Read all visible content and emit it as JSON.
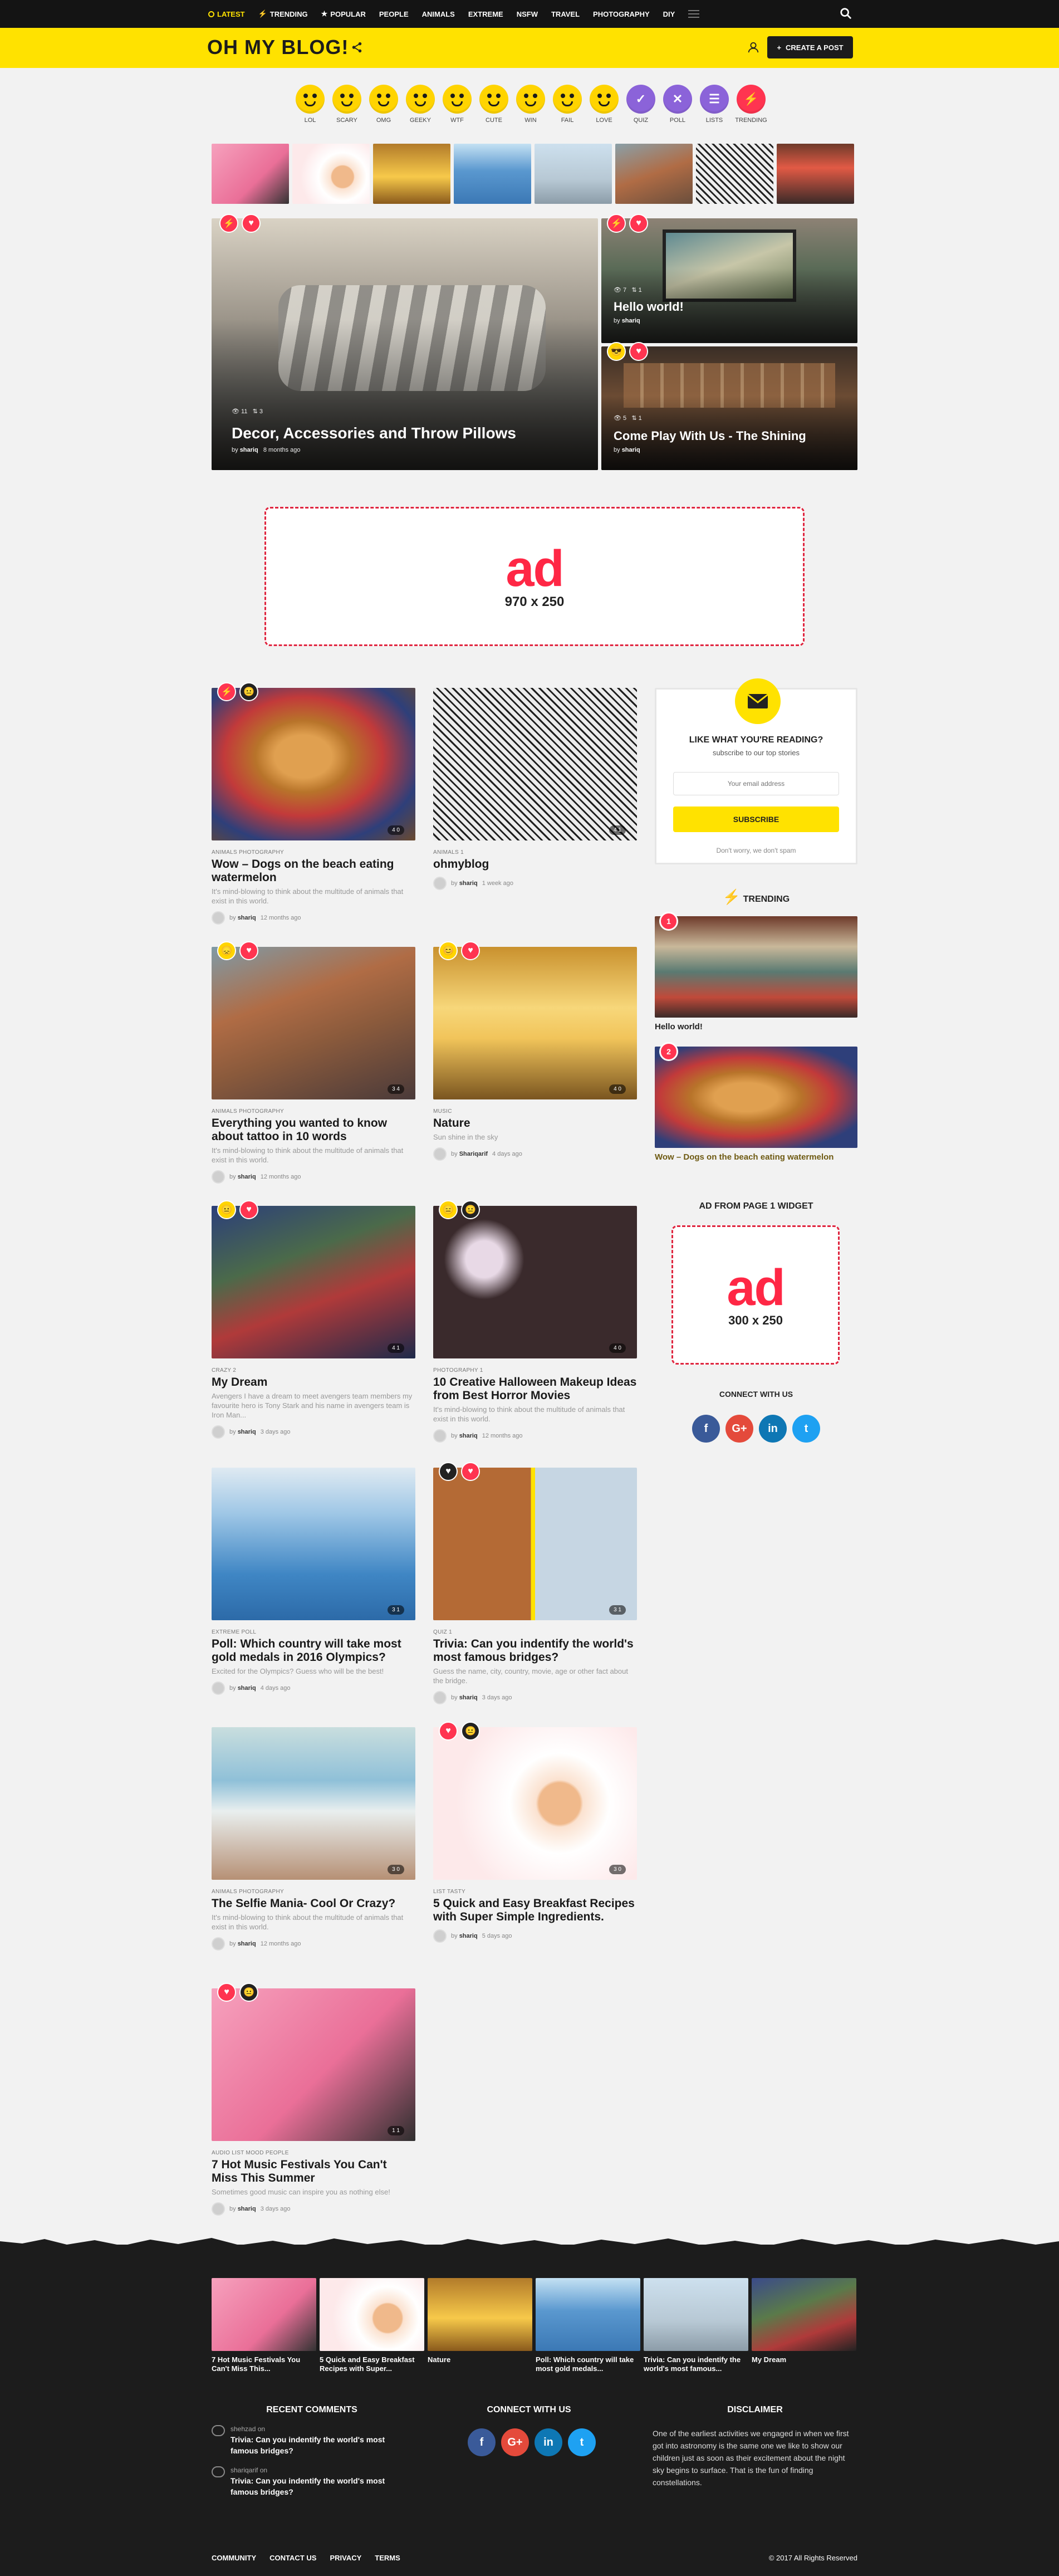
{
  "nav": {
    "items": [
      {
        "label": "LATEST",
        "active": true
      },
      {
        "label": "TRENDING",
        "icon": "bolt-icon"
      },
      {
        "label": "POPULAR",
        "icon": "star-icon"
      },
      {
        "label": "PEOPLE"
      },
      {
        "label": "ANIMALS"
      },
      {
        "label": "EXTREME"
      },
      {
        "label": "NSFW"
      },
      {
        "label": "TRAVEL"
      },
      {
        "label": "PHOTOGRAPHY"
      },
      {
        "label": "DIY"
      }
    ]
  },
  "header": {
    "logo": "OH MY BLOG!",
    "create_label": "CREATE A POST"
  },
  "reactions": [
    "LOL",
    "SCARY",
    "OMG",
    "GEEKY",
    "WTF",
    "CUTE",
    "WIN",
    "FAIL",
    "LOVE",
    "QUIZ",
    "POLL",
    "LISTS",
    "TRENDING"
  ],
  "hero": {
    "main": {
      "title": "Decor, Accessories and Throw Pillows",
      "views": "11",
      "shares": "3",
      "author": "shariq",
      "time": "8 months ago"
    },
    "side1": {
      "title": "Hello world!",
      "views": "7",
      "shares": "1",
      "author": "shariq"
    },
    "side2": {
      "title": "Come Play With Us - The Shining",
      "views": "5",
      "shares": "1",
      "author": "shariq"
    }
  },
  "ad_big": {
    "text": "ad",
    "size": "970 x 250"
  },
  "posts": [
    {
      "cats": "ANIMALS  PHOTOGRAPHY",
      "title": "Wow – Dogs on the beach eating watermelon",
      "excerpt": "It's mind-blowing to think about the multitude of animals that exist in this world.",
      "author": "shariq",
      "time": "12 months ago",
      "stat": "4  0"
    },
    {
      "cats": "ANIMALS  1",
      "title": "ohmyblog",
      "excerpt": "",
      "author": "shariq",
      "time": "1 week ago",
      "stat": "4  1"
    },
    {
      "cats": "ANIMALS  PHOTOGRAPHY",
      "title": "Everything you wanted to know about tattoo in 10 words",
      "excerpt": "It's mind-blowing to think about the multitude of animals that exist in this world.",
      "author": "shariq",
      "time": "12 months ago",
      "stat": "3  4"
    },
    {
      "cats": "MUSIC",
      "title": "Nature",
      "excerpt": "Sun shine in the sky",
      "author": "Shariqarif",
      "time": "4 days ago",
      "stat": "4  0"
    },
    {
      "cats": "CRAZY  2",
      "title": "My Dream",
      "excerpt": "Avengers I have a dream to meet avengers team members my favourite hero is Tony Stark and his name in avengers team is Iron Man...",
      "author": "shariq",
      "time": "3 days ago",
      "stat": "4  1"
    },
    {
      "cats": "PHOTOGRAPHY  1",
      "title": "10 Creative Halloween Makeup Ideas from Best Horror Movies",
      "excerpt": "It's mind-blowing to think about the multitude of animals that exist in this world.",
      "author": "shariq",
      "time": "12 months ago",
      "stat": "4  0"
    },
    {
      "cats": "EXTREME  POLL",
      "title": "Poll: Which country will take most gold medals in 2016 Olympics?",
      "excerpt": "Excited for the Olympics? Guess who will be the best!",
      "author": "shariq",
      "time": "4 days ago",
      "stat": "3  1"
    },
    {
      "cats": "QUIZ  1",
      "title": "Trivia: Can you indentify the world's most famous bridges?",
      "excerpt": "Guess the name, city, country, movie, age or other fact about the bridge.",
      "author": "shariq",
      "time": "3 days ago",
      "stat": "3  1"
    },
    {
      "cats": "ANIMALS  PHOTOGRAPHY",
      "title": "The Selfie Mania- Cool Or Crazy?",
      "excerpt": "It's mind-blowing to think about the multitude of animals that exist in this world.",
      "author": "shariq",
      "time": "12 months ago",
      "stat": "3  0"
    },
    {
      "cats": "LIST  TASTY",
      "title": "5 Quick and Easy Breakfast Recipes with Super Simple Ingredients.",
      "excerpt": "",
      "author": "shariq",
      "time": "5 days ago",
      "stat": "3  0"
    },
    {
      "cats": "AUDIO  LIST  MOOD  PEOPLE",
      "title": "7 Hot Music Festivals You Can't Miss This Summer",
      "excerpt": "Sometimes good music can inspire you as nothing else!",
      "author": "shariq",
      "time": "3 days ago",
      "stat": "1  1"
    }
  ],
  "newsletter": {
    "title": "LIKE WHAT YOU'RE READING?",
    "subtitle": "subscribe to our top stories",
    "placeholder": "Your email address",
    "button": "SUBSCRIBE",
    "note": "Don't worry, we don't spam"
  },
  "trending": {
    "title": "TRENDING",
    "items": [
      {
        "n": "1",
        "title": "Hello world!"
      },
      {
        "n": "2",
        "title": "Wow – Dogs on the beach eating watermelon"
      }
    ]
  },
  "ad_widget": {
    "title": "AD FROM PAGE 1 WIDGET",
    "text": "ad",
    "size": "300 x 250"
  },
  "connect": {
    "title": "CONNECT WITH US",
    "icons": [
      "f",
      "G+",
      "in",
      "t"
    ]
  },
  "footer": {
    "strip": [
      "7 Hot Music Festivals You Can't Miss This...",
      "5 Quick and Easy Breakfast Recipes with Super...",
      "Nature",
      "Poll: Which country will take most gold medals...",
      "Trivia: Can you indentify the world's most famous...",
      "My Dream"
    ],
    "recent_title": "RECENT COMMENTS",
    "comments": [
      {
        "who": "shehzad on",
        "post": "Trivia: Can you indentify the world's most famous bridges?"
      },
      {
        "who": "shariqarif on",
        "post": "Trivia: Can you indentify the world's most famous bridges?"
      }
    ],
    "connect_title": "CONNECT WITH US",
    "disclaimer_title": "DISCLAIMER",
    "disclaimer": "One of the earliest activities we engaged in when we first got into astronomy is the same one we like to show our children just as soon as their excitement about the night sky begins to surface. That is the fun of finding constellations.",
    "links": [
      "COMMUNITY",
      "CONTACT US",
      "PRIVACY",
      "TERMS"
    ],
    "copy": "© 2017 All Rights Reserved"
  },
  "colors": {
    "accent": "#ffe200",
    "red": "#ff3450",
    "dark": "#1c1c1c"
  }
}
